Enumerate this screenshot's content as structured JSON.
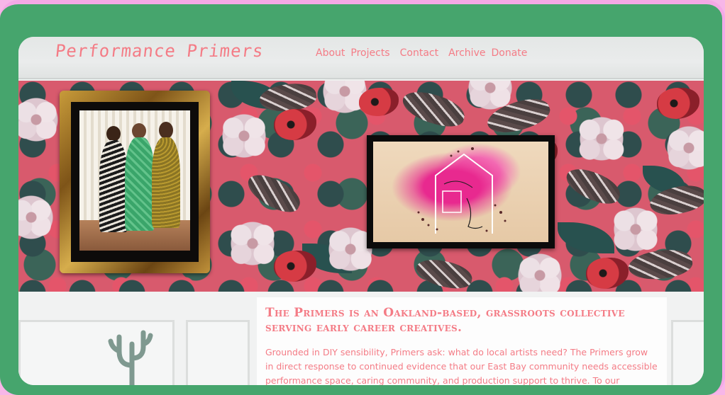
{
  "site": {
    "logo": "Performance Primers"
  },
  "nav": {
    "items": [
      "About",
      "Projects",
      "Contact",
      "Archive",
      "Donate"
    ]
  },
  "content": {
    "headline": "The Primers is an Oakland-based, grassroots collective serving early career creatives.",
    "body": "Grounded in DIY sensibility, Primers ask: what do local artists need? The Primers grow in direct response to continued evidence that our East Bay community needs accessible performance space, caring community, and production support to thrive. To our"
  },
  "colors": {
    "accent": "#f47c86",
    "frame_outer": "#46a56d",
    "frame_border": "#f5a8e6"
  }
}
